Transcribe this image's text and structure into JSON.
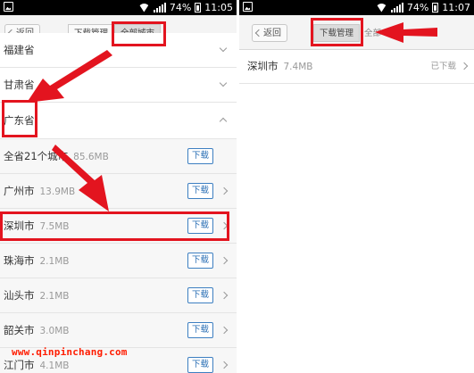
{
  "left_screen": {
    "status": {
      "battery": "74%",
      "time": "11:05"
    },
    "header": {
      "back_label": "返回",
      "tab_download_manager": "下载管理",
      "tab_all_cities": "全部城市"
    },
    "provinces": [
      {
        "name": "福建省",
        "expanded": false
      },
      {
        "name": "甘肃省",
        "expanded": false
      },
      {
        "name": "广东省",
        "expanded": true
      }
    ],
    "cities": [
      {
        "name": "全省21个城市",
        "size": "85.6MB",
        "action": "下载"
      },
      {
        "name": "广州市",
        "size": "13.9MB",
        "action": "下载"
      },
      {
        "name": "深圳市",
        "size": "7.5MB",
        "action": "下载"
      },
      {
        "name": "珠海市",
        "size": "2.1MB",
        "action": "下载"
      },
      {
        "name": "汕头市",
        "size": "2.1MB",
        "action": "下载"
      },
      {
        "name": "韶关市",
        "size": "3.0MB",
        "action": "下载"
      },
      {
        "name": "江门市",
        "size": "4.1MB",
        "action": "下载"
      }
    ]
  },
  "right_screen": {
    "status": {
      "battery": "74%",
      "time": "11:07"
    },
    "header": {
      "back_label": "返回",
      "tab_download_manager": "下载管理",
      "tab_all_cities_partial": "全部"
    },
    "downloads": [
      {
        "name": "深圳市",
        "size": "7.4MB",
        "status": "已下载"
      }
    ]
  },
  "watermark": "www.qinpinchang.com",
  "colors": {
    "annotation_red": "#e3141f",
    "download_blue": "#2a6fb5",
    "watermark": "#ff1c00"
  }
}
